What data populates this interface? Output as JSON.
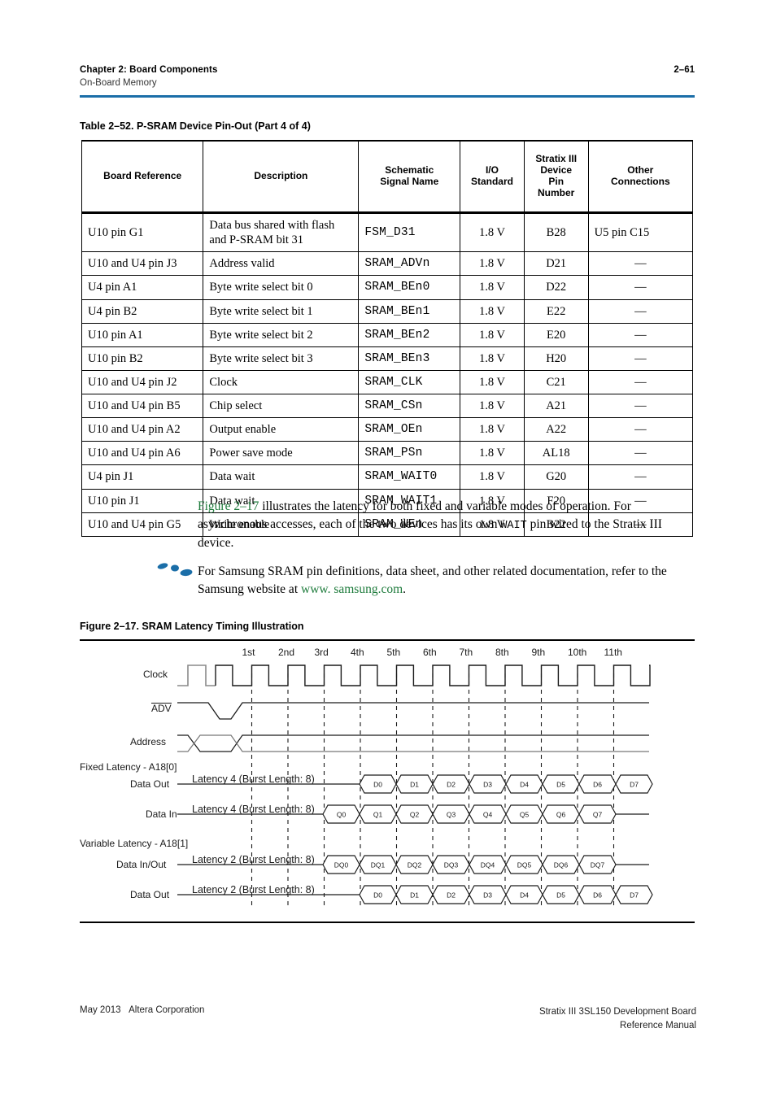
{
  "header": {
    "chapter": "Chapter 2:  Board Components",
    "section": "On-Board Memory",
    "page_number": "2–61",
    "rule_color": "#1b6ea8"
  },
  "table": {
    "caption": "Table 2–52.  P-SRAM Device Pin-Out  (Part 4 of 4)",
    "columns": [
      "Board Reference",
      "Description",
      "Schematic Signal Name",
      "I/O Standard",
      "Stratix III Device Pin Number",
      "Other Connections"
    ],
    "columns_multiline": {
      "c0": "Board Reference",
      "c1": "Description",
      "c2a": "Schematic",
      "c2b": "Signal Name",
      "c3a": "I/O",
      "c3b": "Standard",
      "c4a": "Stratix III",
      "c4b": "Device",
      "c4c": "Pin",
      "c4d": "Number",
      "c5a": "Other",
      "c5b": "Connections"
    },
    "rows": [
      {
        "ref": "U10 pin G1",
        "desc": "Data bus shared with flash and P-SRAM bit 31",
        "sig": "FSM_D31",
        "io": "1.8 V",
        "pin": "B28",
        "other": "U5 pin C15"
      },
      {
        "ref": "U10 and U4 pin J3",
        "desc": "Address valid",
        "sig": "SRAM_ADVn",
        "io": "1.8 V",
        "pin": "D21",
        "other": "—"
      },
      {
        "ref": "U4 pin A1",
        "desc": "Byte write select bit 0",
        "sig": "SRAM_BEn0",
        "io": "1.8 V",
        "pin": "D22",
        "other": "—"
      },
      {
        "ref": "U4 pin B2",
        "desc": "Byte write select bit 1",
        "sig": "SRAM_BEn1",
        "io": "1.8 V",
        "pin": "E22",
        "other": "—"
      },
      {
        "ref": "U10 pin A1",
        "desc": "Byte write select bit 2",
        "sig": "SRAM_BEn2",
        "io": "1.8 V",
        "pin": "E20",
        "other": "—"
      },
      {
        "ref": "U10 pin B2",
        "desc": "Byte write select bit 3",
        "sig": "SRAM_BEn3",
        "io": "1.8 V",
        "pin": "H20",
        "other": "—"
      },
      {
        "ref": "U10 and U4 pin J2",
        "desc": "Clock",
        "sig": "SRAM_CLK",
        "io": "1.8 V",
        "pin": "C21",
        "other": "—"
      },
      {
        "ref": "U10 and U4 pin B5",
        "desc": "Chip select",
        "sig": "SRAM_CSn",
        "io": "1.8 V",
        "pin": "A21",
        "other": "—"
      },
      {
        "ref": "U10 and U4 pin A2",
        "desc": "Output enable",
        "sig": "SRAM_OEn",
        "io": "1.8 V",
        "pin": "A22",
        "other": "—"
      },
      {
        "ref": "U10 and U4 pin A6",
        "desc": "Power save mode",
        "sig": "SRAM_PSn",
        "io": "1.8 V",
        "pin": "AL18",
        "other": "—"
      },
      {
        "ref": "U4 pin J1",
        "desc": "Data wait",
        "sig": "SRAM_WAIT0",
        "io": "1.8 V",
        "pin": "G20",
        "other": "—"
      },
      {
        "ref": "U10 pin J1",
        "desc": "Data wait",
        "sig": "SRAM_WAIT1",
        "io": "1.8 V",
        "pin": "F20",
        "other": "—"
      },
      {
        "ref": "U10 and U4 pin G5",
        "desc": "Write enable",
        "sig": "SRAM_WEn",
        "io": "1.8 V",
        "pin": "B22",
        "other": "—"
      }
    ]
  },
  "body": {
    "para1_link": "Figure 2–17",
    "para1_rest_a": " illustrates the latency for both fixed and variable modes of operation. For asynchronous accesses, each of the two devices has its own ",
    "para1_mono": "WAIT",
    "para1_rest_b": " pin wired to the Stratix III device.",
    "note_a": "For Samsung SRAM pin definitions, data sheet, and other related documentation, refer to the Samsung website at ",
    "note_link": "www. samsung.com",
    "note_b": ".",
    "link_color": "#1e7b3c"
  },
  "figure": {
    "caption": "Figure 2–17.  SRAM Latency Timing Illustration",
    "cycle_labels": [
      "1st",
      "2nd",
      "3rd",
      "4th",
      "5th",
      "6th",
      "7th",
      "8th",
      "9th",
      "10th",
      "11th"
    ],
    "signal_labels": {
      "clock": "Clock",
      "adv": "ADV",
      "address": "Address",
      "fixed_latency": "Fixed Latency - A18[0]",
      "data_out_1": "Data Out",
      "data_in": "Data In",
      "variable_latency": "Variable Latency - A18[1]",
      "data_inout": "Data In/Out",
      "data_out_2": "Data Out"
    },
    "burst_notes": {
      "row1": "Latency 4 (Burst Length: 8)",
      "row2": "Latency 4 (Burst Length: 8)",
      "row3": "Latency 2 (Burst Length: 8)",
      "row4": "Latency 2 (Burst Length: 8)"
    },
    "bus_values": {
      "data_out_1": [
        "D0",
        "D1",
        "D2",
        "D3",
        "D4",
        "D5",
        "D6",
        "D7"
      ],
      "data_in": [
        "Q0",
        "Q1",
        "Q2",
        "Q3",
        "Q4",
        "Q5",
        "Q6",
        "Q7"
      ],
      "data_inout": [
        "DQ0",
        "DQ1",
        "DQ2",
        "DQ3",
        "DQ4",
        "DQ5",
        "DQ6",
        "DQ7"
      ],
      "data_out_2": [
        "D0",
        "D1",
        "D2",
        "D3",
        "D4",
        "D5",
        "D6",
        "D7"
      ]
    }
  },
  "footer": {
    "left_date": "May 2013",
    "left_company": "Altera Corporation",
    "right_line1": "Stratix III 3SL150 Development Board",
    "right_line2": "Reference Manual"
  }
}
